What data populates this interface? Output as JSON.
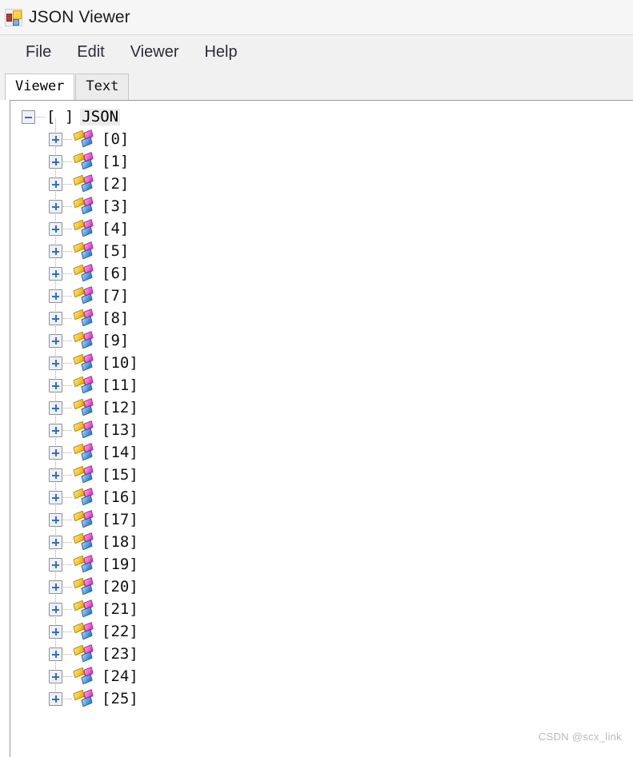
{
  "window": {
    "title": "JSON Viewer",
    "app_icon": "app-window-icon"
  },
  "menubar": {
    "items": [
      {
        "label": "File"
      },
      {
        "label": "Edit"
      },
      {
        "label": "Viewer"
      },
      {
        "label": "Help"
      }
    ]
  },
  "tabs": {
    "active": "Viewer",
    "items": [
      {
        "label": "Viewer",
        "active": true
      },
      {
        "label": "Text",
        "active": false
      }
    ]
  },
  "tree": {
    "root": {
      "bracket": "[ ]",
      "label": "JSON",
      "expanded": true,
      "selected": true,
      "expander_icon": "minus-box-icon"
    },
    "children": [
      {
        "label": "[0]",
        "expanded": false,
        "icon": "json-object-icon"
      },
      {
        "label": "[1]",
        "expanded": false,
        "icon": "json-object-icon"
      },
      {
        "label": "[2]",
        "expanded": false,
        "icon": "json-object-icon"
      },
      {
        "label": "[3]",
        "expanded": false,
        "icon": "json-object-icon"
      },
      {
        "label": "[4]",
        "expanded": false,
        "icon": "json-object-icon"
      },
      {
        "label": "[5]",
        "expanded": false,
        "icon": "json-object-icon"
      },
      {
        "label": "[6]",
        "expanded": false,
        "icon": "json-object-icon"
      },
      {
        "label": "[7]",
        "expanded": false,
        "icon": "json-object-icon"
      },
      {
        "label": "[8]",
        "expanded": false,
        "icon": "json-object-icon"
      },
      {
        "label": "[9]",
        "expanded": false,
        "icon": "json-object-icon"
      },
      {
        "label": "[10]",
        "expanded": false,
        "icon": "json-object-icon"
      },
      {
        "label": "[11]",
        "expanded": false,
        "icon": "json-object-icon"
      },
      {
        "label": "[12]",
        "expanded": false,
        "icon": "json-object-icon"
      },
      {
        "label": "[13]",
        "expanded": false,
        "icon": "json-object-icon"
      },
      {
        "label": "[14]",
        "expanded": false,
        "icon": "json-object-icon"
      },
      {
        "label": "[15]",
        "expanded": false,
        "icon": "json-object-icon"
      },
      {
        "label": "[16]",
        "expanded": false,
        "icon": "json-object-icon"
      },
      {
        "label": "[17]",
        "expanded": false,
        "icon": "json-object-icon"
      },
      {
        "label": "[18]",
        "expanded": false,
        "icon": "json-object-icon"
      },
      {
        "label": "[19]",
        "expanded": false,
        "icon": "json-object-icon"
      },
      {
        "label": "[20]",
        "expanded": false,
        "icon": "json-object-icon"
      },
      {
        "label": "[21]",
        "expanded": false,
        "icon": "json-object-icon"
      },
      {
        "label": "[22]",
        "expanded": false,
        "icon": "json-object-icon"
      },
      {
        "label": "[23]",
        "expanded": false,
        "icon": "json-object-icon"
      },
      {
        "label": "[24]",
        "expanded": false,
        "icon": "json-object-icon"
      },
      {
        "label": "[25]",
        "expanded": false,
        "icon": "json-object-icon"
      }
    ]
  },
  "watermark": {
    "text": "CSDN @scx_link"
  },
  "colors": {
    "titlebar_bg": "#f6f6f6",
    "menubar_bg": "#f1f1f1",
    "panel_bg": "#ffffff",
    "selection_bg": "#ebebeb",
    "expander_glyph": "#2d6fc4",
    "watermark": "#b9b9b9"
  }
}
